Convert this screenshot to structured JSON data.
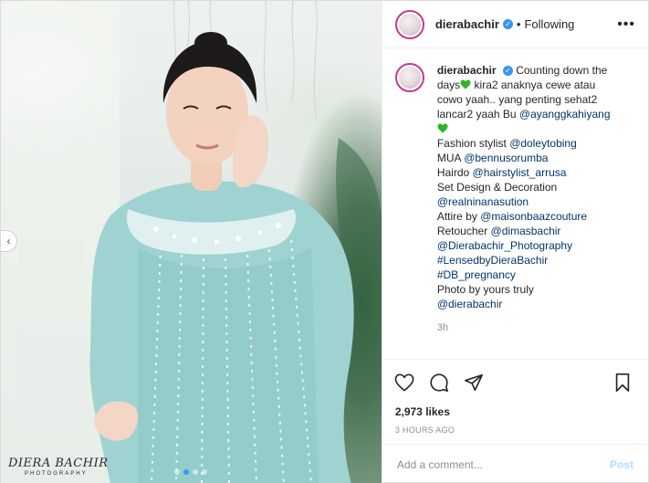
{
  "header": {
    "username": "dierabachir",
    "separator": "•",
    "follow_state": "Following",
    "more_label": "•••"
  },
  "photo": {
    "watermark_main": "DIERA BACHIR",
    "watermark_sub": "PHOTOGRAPHY",
    "carousel_prev": "‹",
    "slide_count": 4,
    "active_slide": 2
  },
  "caption": {
    "username": "dierabachir",
    "lines": [
      "Counting down the",
      "days",
      "kira2 anaknya cewe atau",
      "cowo yaah.. yang penting sehat2",
      "lancar2 yaah Bu",
      "@ayanggkahiyang",
      "Fashion stylist",
      "@doleytobing",
      "MUA",
      "@bennusorumba",
      "Hairdo",
      "@hairstylist_arrusa",
      "Set Design & Decoration",
      "@realninanasution",
      "Attire by",
      "@maisonbaazcouture",
      "Retoucher",
      "@dimasbachir",
      "@Dierabachir_Photography",
      "#LensedbyDieraBachir",
      "#DB_pregnancy",
      "Photo by yours truly",
      "@dierabachir"
    ],
    "time": "3h"
  },
  "actions": {
    "likes": "2,973 likes",
    "timestamp": "3 HOURS AGO"
  },
  "comment": {
    "placeholder": "Add a comment...",
    "post_label": "Post"
  },
  "colors": {
    "verified": "#3897f0",
    "link": "#003569",
    "heart": "#2ab52a",
    "post_disabled": "#b3dbff"
  }
}
